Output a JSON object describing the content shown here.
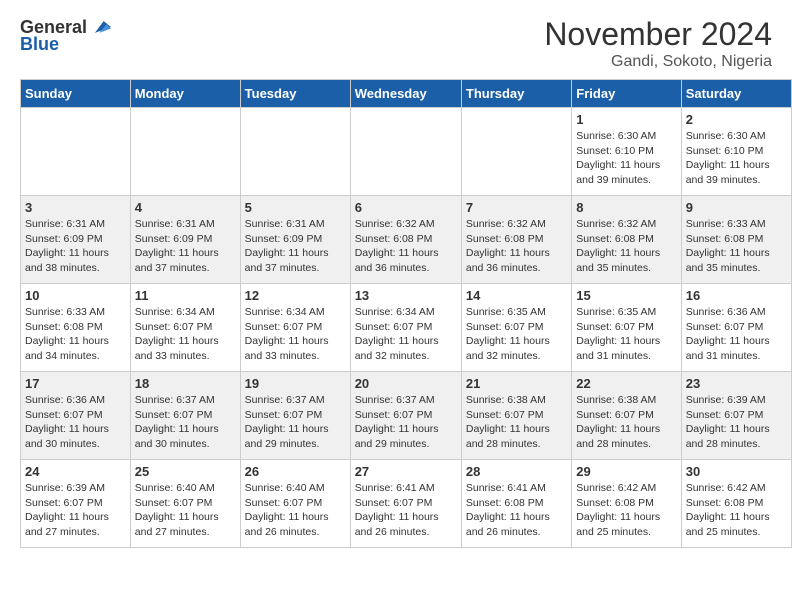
{
  "header": {
    "logo": {
      "general": "General",
      "blue": "Blue"
    },
    "title": "November 2024",
    "location": "Gandi, Sokoto, Nigeria"
  },
  "calendar": {
    "days_of_week": [
      "Sunday",
      "Monday",
      "Tuesday",
      "Wednesday",
      "Thursday",
      "Friday",
      "Saturday"
    ],
    "rows": [
      {
        "cells": [
          {
            "day": "",
            "info": ""
          },
          {
            "day": "",
            "info": ""
          },
          {
            "day": "",
            "info": ""
          },
          {
            "day": "",
            "info": ""
          },
          {
            "day": "",
            "info": ""
          },
          {
            "day": "1",
            "info": "Sunrise: 6:30 AM\nSunset: 6:10 PM\nDaylight: 11 hours and 39 minutes."
          },
          {
            "day": "2",
            "info": "Sunrise: 6:30 AM\nSunset: 6:10 PM\nDaylight: 11 hours and 39 minutes."
          }
        ]
      },
      {
        "cells": [
          {
            "day": "3",
            "info": "Sunrise: 6:31 AM\nSunset: 6:09 PM\nDaylight: 11 hours and 38 minutes."
          },
          {
            "day": "4",
            "info": "Sunrise: 6:31 AM\nSunset: 6:09 PM\nDaylight: 11 hours and 37 minutes."
          },
          {
            "day": "5",
            "info": "Sunrise: 6:31 AM\nSunset: 6:09 PM\nDaylight: 11 hours and 37 minutes."
          },
          {
            "day": "6",
            "info": "Sunrise: 6:32 AM\nSunset: 6:08 PM\nDaylight: 11 hours and 36 minutes."
          },
          {
            "day": "7",
            "info": "Sunrise: 6:32 AM\nSunset: 6:08 PM\nDaylight: 11 hours and 36 minutes."
          },
          {
            "day": "8",
            "info": "Sunrise: 6:32 AM\nSunset: 6:08 PM\nDaylight: 11 hours and 35 minutes."
          },
          {
            "day": "9",
            "info": "Sunrise: 6:33 AM\nSunset: 6:08 PM\nDaylight: 11 hours and 35 minutes."
          }
        ]
      },
      {
        "cells": [
          {
            "day": "10",
            "info": "Sunrise: 6:33 AM\nSunset: 6:08 PM\nDaylight: 11 hours and 34 minutes."
          },
          {
            "day": "11",
            "info": "Sunrise: 6:34 AM\nSunset: 6:07 PM\nDaylight: 11 hours and 33 minutes."
          },
          {
            "day": "12",
            "info": "Sunrise: 6:34 AM\nSunset: 6:07 PM\nDaylight: 11 hours and 33 minutes."
          },
          {
            "day": "13",
            "info": "Sunrise: 6:34 AM\nSunset: 6:07 PM\nDaylight: 11 hours and 32 minutes."
          },
          {
            "day": "14",
            "info": "Sunrise: 6:35 AM\nSunset: 6:07 PM\nDaylight: 11 hours and 32 minutes."
          },
          {
            "day": "15",
            "info": "Sunrise: 6:35 AM\nSunset: 6:07 PM\nDaylight: 11 hours and 31 minutes."
          },
          {
            "day": "16",
            "info": "Sunrise: 6:36 AM\nSunset: 6:07 PM\nDaylight: 11 hours and 31 minutes."
          }
        ]
      },
      {
        "cells": [
          {
            "day": "17",
            "info": "Sunrise: 6:36 AM\nSunset: 6:07 PM\nDaylight: 11 hours and 30 minutes."
          },
          {
            "day": "18",
            "info": "Sunrise: 6:37 AM\nSunset: 6:07 PM\nDaylight: 11 hours and 30 minutes."
          },
          {
            "day": "19",
            "info": "Sunrise: 6:37 AM\nSunset: 6:07 PM\nDaylight: 11 hours and 29 minutes."
          },
          {
            "day": "20",
            "info": "Sunrise: 6:37 AM\nSunset: 6:07 PM\nDaylight: 11 hours and 29 minutes."
          },
          {
            "day": "21",
            "info": "Sunrise: 6:38 AM\nSunset: 6:07 PM\nDaylight: 11 hours and 28 minutes."
          },
          {
            "day": "22",
            "info": "Sunrise: 6:38 AM\nSunset: 6:07 PM\nDaylight: 11 hours and 28 minutes."
          },
          {
            "day": "23",
            "info": "Sunrise: 6:39 AM\nSunset: 6:07 PM\nDaylight: 11 hours and 28 minutes."
          }
        ]
      },
      {
        "cells": [
          {
            "day": "24",
            "info": "Sunrise: 6:39 AM\nSunset: 6:07 PM\nDaylight: 11 hours and 27 minutes."
          },
          {
            "day": "25",
            "info": "Sunrise: 6:40 AM\nSunset: 6:07 PM\nDaylight: 11 hours and 27 minutes."
          },
          {
            "day": "26",
            "info": "Sunrise: 6:40 AM\nSunset: 6:07 PM\nDaylight: 11 hours and 26 minutes."
          },
          {
            "day": "27",
            "info": "Sunrise: 6:41 AM\nSunset: 6:07 PM\nDaylight: 11 hours and 26 minutes."
          },
          {
            "day": "28",
            "info": "Sunrise: 6:41 AM\nSunset: 6:08 PM\nDaylight: 11 hours and 26 minutes."
          },
          {
            "day": "29",
            "info": "Sunrise: 6:42 AM\nSunset: 6:08 PM\nDaylight: 11 hours and 25 minutes."
          },
          {
            "day": "30",
            "info": "Sunrise: 6:42 AM\nSunset: 6:08 PM\nDaylight: 11 hours and 25 minutes."
          }
        ]
      }
    ]
  }
}
